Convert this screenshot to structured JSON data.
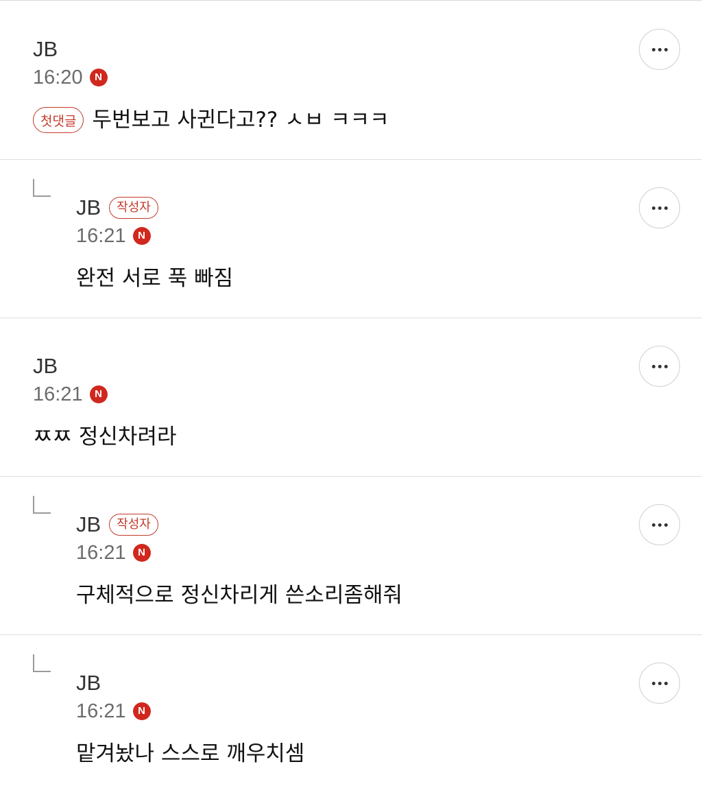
{
  "comments": [
    {
      "author": "JB",
      "time": "16:20",
      "new_badge": "N",
      "first_comment_badge": "첫댓글",
      "text": "두번보고 사귄다고?? ㅅㅂ ㅋㅋㅋ",
      "is_reply": false,
      "is_writer": false
    },
    {
      "author": "JB",
      "writer_badge": "작성자",
      "time": "16:21",
      "new_badge": "N",
      "text": "완전 서로 푹 빠짐",
      "is_reply": true,
      "is_writer": true
    },
    {
      "author": "JB",
      "time": "16:21",
      "new_badge": "N",
      "text": "ㅉㅉ 정신차려라",
      "is_reply": false,
      "is_writer": false
    },
    {
      "author": "JB",
      "writer_badge": "작성자",
      "time": "16:21",
      "new_badge": "N",
      "text": "구체적으로 정신차리게 쓴소리좀해줘",
      "is_reply": true,
      "is_writer": true
    },
    {
      "author": "JB",
      "time": "16:21",
      "new_badge": "N",
      "text": "맡겨놨나 스스로 깨우치셈",
      "is_reply": true,
      "is_writer": false
    }
  ],
  "icons": {
    "more": "more-horizontal-icon",
    "reply": "reply-corner-icon",
    "new": "new-badge-icon"
  },
  "colors": {
    "accent_red": "#c23a2b",
    "new_badge_red": "#d0281e",
    "time_gray": "#6b6b6b",
    "divider": "#dedede"
  }
}
